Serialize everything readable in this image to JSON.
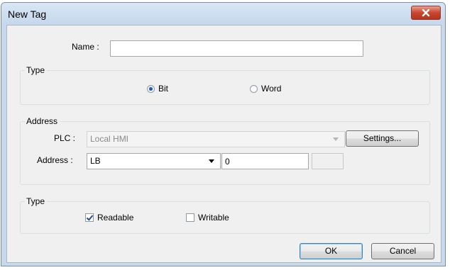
{
  "window": {
    "title": "New Tag"
  },
  "name_field": {
    "label": "Name :",
    "value": ""
  },
  "type_group": {
    "title": "Type",
    "options": [
      {
        "label": "Bit",
        "selected": true
      },
      {
        "label": "Word",
        "selected": false
      }
    ]
  },
  "address_group": {
    "title": "Address",
    "plc_label": "PLC :",
    "plc_value": "Local HMI",
    "settings_label": "Settings...",
    "address_label": "Address :",
    "address_device": "LB",
    "address_value": "0",
    "address_extra": ""
  },
  "access_group": {
    "title": "Type",
    "readable": {
      "label": "Readable",
      "checked": true
    },
    "writable": {
      "label": "Writable",
      "checked": false
    }
  },
  "buttons": {
    "ok": "OK",
    "cancel": "Cancel"
  },
  "colors": {
    "accent": "#1f5fae",
    "close": "#c9452c",
    "client_bg": "#f0f0f0"
  }
}
